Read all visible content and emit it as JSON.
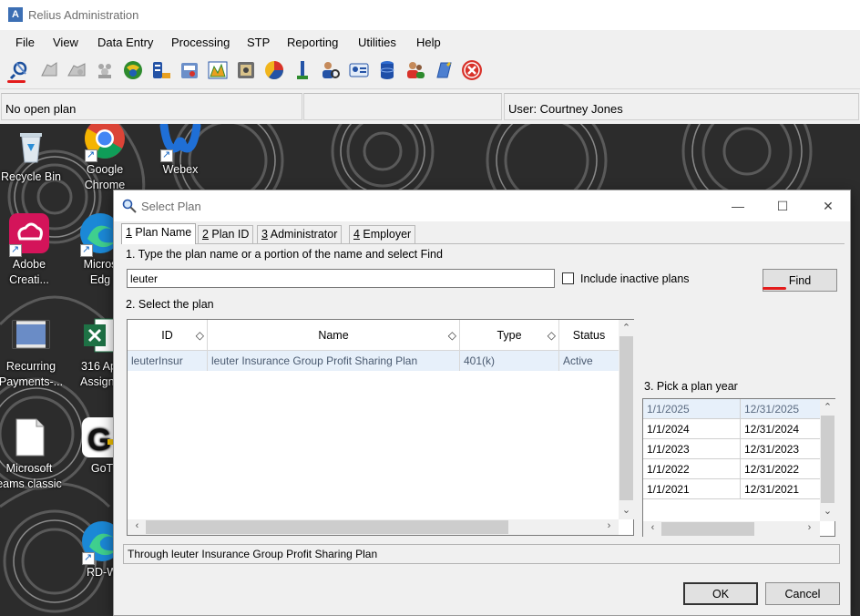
{
  "app": {
    "title": "Relius Administration",
    "icon_letter": "A"
  },
  "menu": [
    "File",
    "View",
    "Data Entry",
    "Processing",
    "STP",
    "Reporting",
    "Utilities",
    "Help"
  ],
  "toolbar_icons": [
    "find-plan-icon",
    "plan-icon",
    "plan-copy-icon",
    "employees-icon",
    "compliance-icon",
    "database-export-icon",
    "calculator-icon",
    "chart-icon",
    "safe-icon",
    "pie-chart-icon",
    "user-flag-icon",
    "user-search-icon",
    "id-card-icon",
    "database-icon",
    "people-icon",
    "notebook-icon",
    "exit-icon"
  ],
  "status": {
    "plan": "No open plan",
    "middle": "",
    "user": "User: Courtney Jones"
  },
  "desktop_icons": [
    {
      "name": "recycle-bin",
      "label": "Recycle Bin",
      "label2": ""
    },
    {
      "name": "google-chrome",
      "label": "Google",
      "label2": "Chrome"
    },
    {
      "name": "webex",
      "label": "Webex",
      "label2": ""
    },
    {
      "name": "adobe-creative-cloud",
      "label": "Adobe",
      "label2": "Creati..."
    },
    {
      "name": "microsoft-edge",
      "label": "Micros",
      "label2": "Edg"
    },
    {
      "name": "recurring-payments",
      "label": "Recurring",
      "label2": "Payments-..."
    },
    {
      "name": "excel-316-app",
      "label": "316 App",
      "label2": "Assignm"
    },
    {
      "name": "microsoft-teams-classic",
      "label": "Microsoft",
      "label2": "eams classic"
    },
    {
      "name": "goto",
      "label": "GoT",
      "label2": ""
    },
    {
      "name": "rd-web",
      "label": "RD-W",
      "label2": ""
    }
  ],
  "dialog": {
    "title": "Select Plan",
    "tabs": [
      {
        "key": "1",
        "label": " Plan Name"
      },
      {
        "key": "2",
        "label": " Plan ID"
      },
      {
        "key": "3",
        "label": " Administrator"
      },
      {
        "key": "4",
        "label": " Employer"
      }
    ],
    "step1": "1. Type the plan name or a portion of the name and select Find",
    "search_value": "leuter",
    "include_inactive": "Include inactive plans",
    "find_label": "Find",
    "step2": "2. Select the plan",
    "columns": [
      "ID",
      "Name",
      "Type",
      "Status"
    ],
    "rows": [
      {
        "id": "leuterInsur",
        "name": "leuter Insurance Group Profit Sharing Plan",
        "type": "401(k)",
        "status": "Active"
      }
    ],
    "step3": "3. Pick a plan year",
    "plan_years": [
      {
        "start": "1/1/2025",
        "end": "12/31/2025"
      },
      {
        "start": "1/1/2024",
        "end": "12/31/2024"
      },
      {
        "start": "1/1/2023",
        "end": "12/31/2023"
      },
      {
        "start": "1/1/2022",
        "end": "12/31/2022"
      },
      {
        "start": "1/1/2021",
        "end": "12/31/2021"
      }
    ],
    "description": "Through leuter Insurance Group Profit Sharing Plan",
    "ok_label": "OK",
    "cancel_label": "Cancel"
  }
}
